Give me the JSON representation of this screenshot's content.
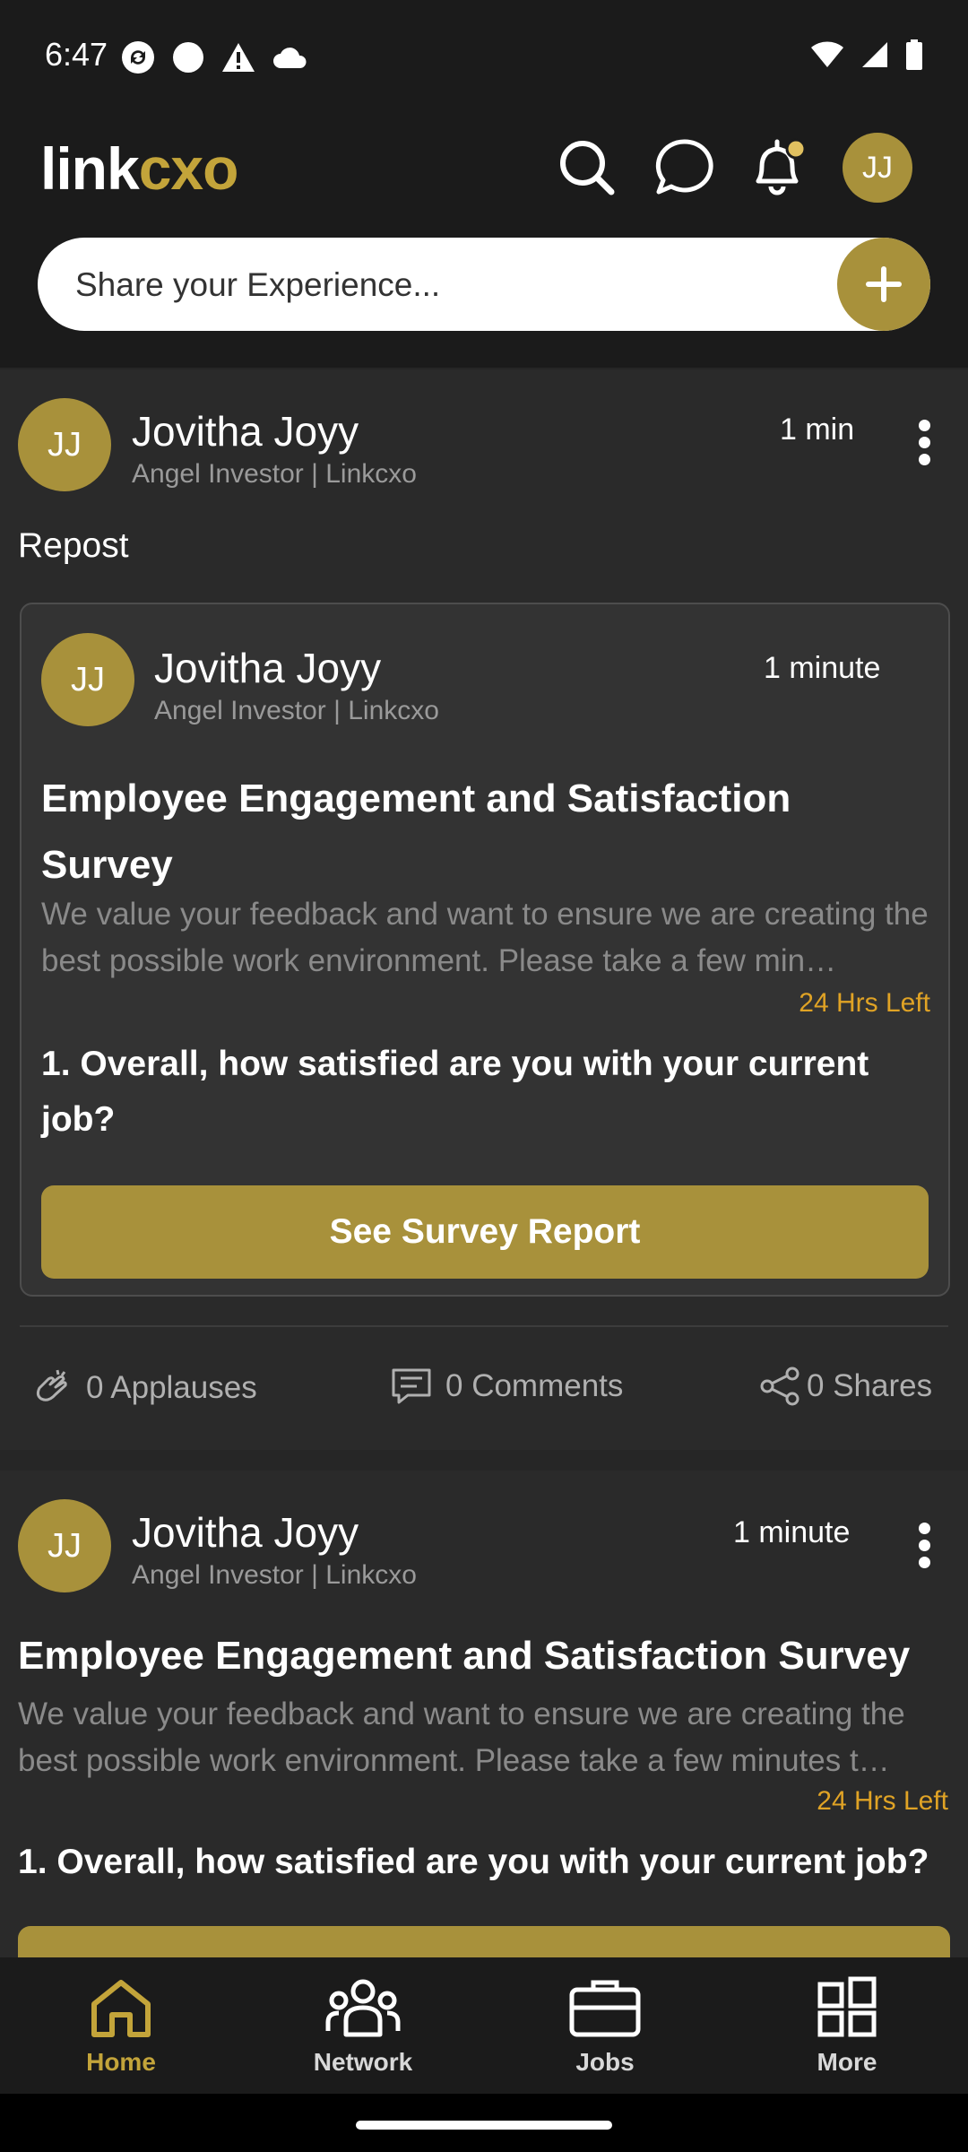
{
  "status_bar": {
    "time": "6:47"
  },
  "header": {
    "logo_part1": "link",
    "logo_part2": "cxo",
    "avatar_initials": "JJ",
    "share_placeholder": "Share your Experience..."
  },
  "post1": {
    "avatar": "JJ",
    "author": "Jovitha Joyy",
    "subtitle": "Angel Investor | Linkcxo",
    "time": "1 min",
    "repost_label": "Repost",
    "inner": {
      "avatar": "JJ",
      "author": "Jovitha Joyy",
      "subtitle": "Angel Investor | Linkcxo",
      "time": "1 minute",
      "title": "Employee Engagement and Satisfaction Survey",
      "description": "We value your feedback and want to ensure we are creating the best possible work environment. Please take a few min…",
      "hrs_left": "24 Hrs Left",
      "question": "1. Overall, how satisfied are you with your current job?",
      "button": "See Survey Report"
    },
    "stats": {
      "applauses": "0 Applauses",
      "comments": "0 Comments",
      "shares": "0 Shares"
    }
  },
  "post2": {
    "avatar": "JJ",
    "author": "Jovitha Joyy",
    "subtitle": "Angel Investor | Linkcxo",
    "time": "1 minute",
    "title": "Employee Engagement and Satisfaction Survey",
    "description": "We value your feedback and want to ensure we are creating the best possible work environment. Please take a few minutes t…",
    "hrs_left": "24 Hrs Left",
    "question": "1. Overall, how satisfied are you with your current job?"
  },
  "nav": {
    "items": [
      {
        "label": "Home",
        "active": true
      },
      {
        "label": "Network",
        "active": false
      },
      {
        "label": "Jobs",
        "active": false
      },
      {
        "label": "More",
        "active": false
      }
    ]
  },
  "colors": {
    "accent": "#a8913b",
    "hrs_left": "#e0a325",
    "background": "#262626"
  }
}
